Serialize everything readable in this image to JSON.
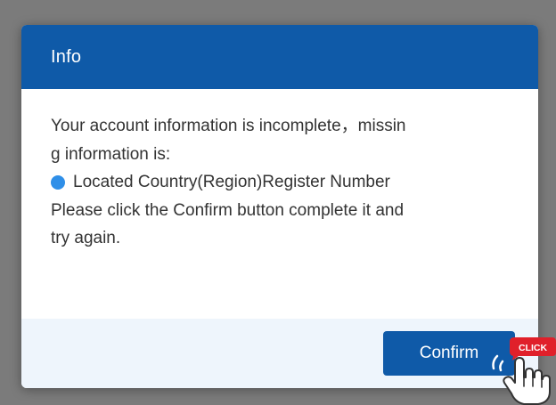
{
  "dialog": {
    "title": "Info",
    "body": {
      "line1": "Your account information is incomplete，missin",
      "line2": "g information is:",
      "missing_item": "Located Country(Region)Register Number",
      "line3": "Please click the Confirm button complete it and",
      "line4": "try again."
    },
    "confirm_label": "Confirm"
  },
  "overlay": {
    "click_badge": "CLICK"
  },
  "colors": {
    "header": "#0f5aa8",
    "button": "#0f5aa8",
    "bullet": "#2f8fe8",
    "footer": "#eef5fc",
    "click_badge": "#e0202a"
  },
  "icons": {
    "bullet": "dot-icon",
    "pointer": "hand-pointer-icon"
  }
}
